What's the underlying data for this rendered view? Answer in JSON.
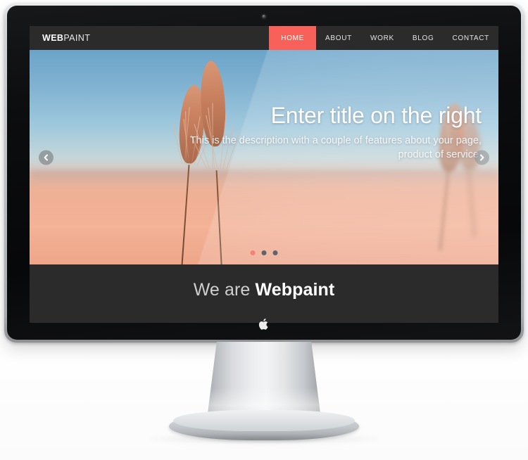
{
  "device": {
    "kind": "imac-desktop-monitor",
    "brand_logo": "apple-logo",
    "camera": "webcam-dot"
  },
  "site": {
    "logo": {
      "bold_part": "WEB",
      "light_part": "PAINT",
      "full": "WEBPAINT"
    },
    "nav": {
      "items": [
        {
          "label": "HOME",
          "active": true
        },
        {
          "label": "ABOUT",
          "active": false
        },
        {
          "label": "WORK",
          "active": false
        },
        {
          "label": "BLOG",
          "active": false
        },
        {
          "label": "CONTACT",
          "active": false
        }
      ]
    },
    "hero": {
      "title": "Enter title on the right",
      "description": "This is the description with a couple of features about your page, product of service.",
      "prev_arrow_icon": "chevron-left-icon",
      "next_arrow_icon": "chevron-right-icon",
      "dots": [
        {
          "active": true
        },
        {
          "active": false
        },
        {
          "active": false
        }
      ]
    },
    "about": {
      "heading_light": "We are ",
      "heading_bold": "Webpaint",
      "subtext": ""
    }
  },
  "colors": {
    "accent_red": "#f8615a",
    "header_dark": "#2b2b2b",
    "section_dark": "#2b2b2b",
    "text_white": "#ffffff",
    "sky_blue": "#6ba4c9",
    "field_peach": "#f3b49b",
    "bezel_black": "#0c0d0f",
    "aluminum": "#c3c6ca"
  }
}
